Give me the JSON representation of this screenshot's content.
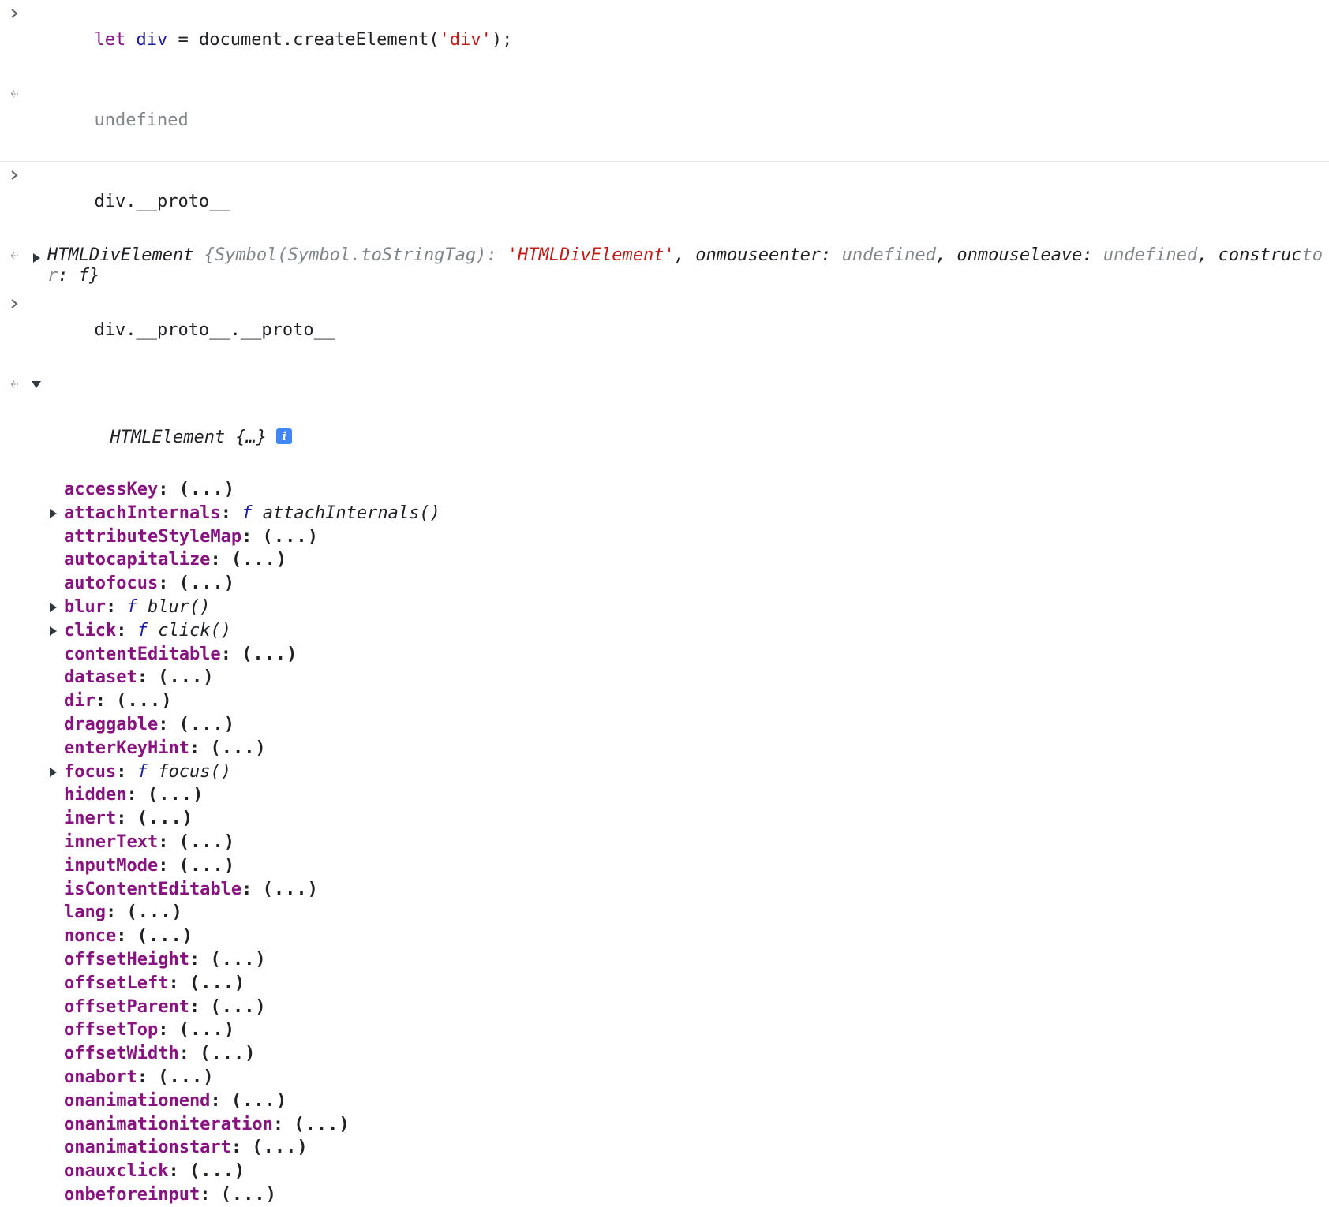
{
  "entries": [
    {
      "input": {
        "keyword": "let",
        "variable": "div",
        "rest_before": " = document.createElement(",
        "string": "'div'",
        "rest_after": ");"
      },
      "output": "undefined"
    },
    {
      "input": "div.__proto__",
      "output": {
        "type_name": "HTMLDivElement",
        "open_brace": " {",
        "k1": "Symbol(Symbol.toStringTag)",
        "v1": "'HTMLDivElement'",
        "k2": "onmouseenter",
        "v2": "undefined",
        "k3": "onmouseleave",
        "v3": "undefined",
        "k4_part1": "construc",
        "k4_part2": "tor",
        "v4": "f",
        "close_brace": "}"
      }
    },
    {
      "input": "div.__proto__.__proto__",
      "output": {
        "type_name": "HTMLElement",
        "preview": " {…}",
        "info_badge": "i",
        "properties": [
          {
            "name": "accessKey",
            "value": "(...)",
            "expandable": false
          },
          {
            "name": "attachInternals",
            "fn": "attachInternals()",
            "expandable": true
          },
          {
            "name": "attributeStyleMap",
            "value": "(...)",
            "expandable": false
          },
          {
            "name": "autocapitalize",
            "value": "(...)",
            "expandable": false
          },
          {
            "name": "autofocus",
            "value": "(...)",
            "expandable": false
          },
          {
            "name": "blur",
            "fn": "blur()",
            "expandable": true
          },
          {
            "name": "click",
            "fn": "click()",
            "expandable": true
          },
          {
            "name": "contentEditable",
            "value": "(...)",
            "expandable": false
          },
          {
            "name": "dataset",
            "value": "(...)",
            "expandable": false
          },
          {
            "name": "dir",
            "value": "(...)",
            "expandable": false
          },
          {
            "name": "draggable",
            "value": "(...)",
            "expandable": false
          },
          {
            "name": "enterKeyHint",
            "value": "(...)",
            "expandable": false
          },
          {
            "name": "focus",
            "fn": "focus()",
            "expandable": true
          },
          {
            "name": "hidden",
            "value": "(...)",
            "expandable": false
          },
          {
            "name": "inert",
            "value": "(...)",
            "expandable": false
          },
          {
            "name": "innerText",
            "value": "(...)",
            "expandable": false
          },
          {
            "name": "inputMode",
            "value": "(...)",
            "expandable": false
          },
          {
            "name": "isContentEditable",
            "value": "(...)",
            "expandable": false
          },
          {
            "name": "lang",
            "value": "(...)",
            "expandable": false
          },
          {
            "name": "nonce",
            "value": "(...)",
            "expandable": false
          },
          {
            "name": "offsetHeight",
            "value": "(...)",
            "expandable": false
          },
          {
            "name": "offsetLeft",
            "value": "(...)",
            "expandable": false
          },
          {
            "name": "offsetParent",
            "value": "(...)",
            "expandable": false
          },
          {
            "name": "offsetTop",
            "value": "(...)",
            "expandable": false
          },
          {
            "name": "offsetWidth",
            "value": "(...)",
            "expandable": false
          },
          {
            "name": "onabort",
            "value": "(...)",
            "expandable": false
          },
          {
            "name": "onanimationend",
            "value": "(...)",
            "expandable": false
          },
          {
            "name": "onanimationiteration",
            "value": "(...)",
            "expandable": false
          },
          {
            "name": "onanimationstart",
            "value": "(...)",
            "expandable": false
          },
          {
            "name": "onauxclick",
            "value": "(...)",
            "expandable": false
          },
          {
            "name": "onbeforeinput",
            "value": "(...)",
            "expandable": false
          }
        ]
      }
    }
  ],
  "function_marker": "f",
  "colors": {
    "keyword": "#881280",
    "variable": "#1a1aa6",
    "string": "#c41a16",
    "muted": "#80868b"
  }
}
